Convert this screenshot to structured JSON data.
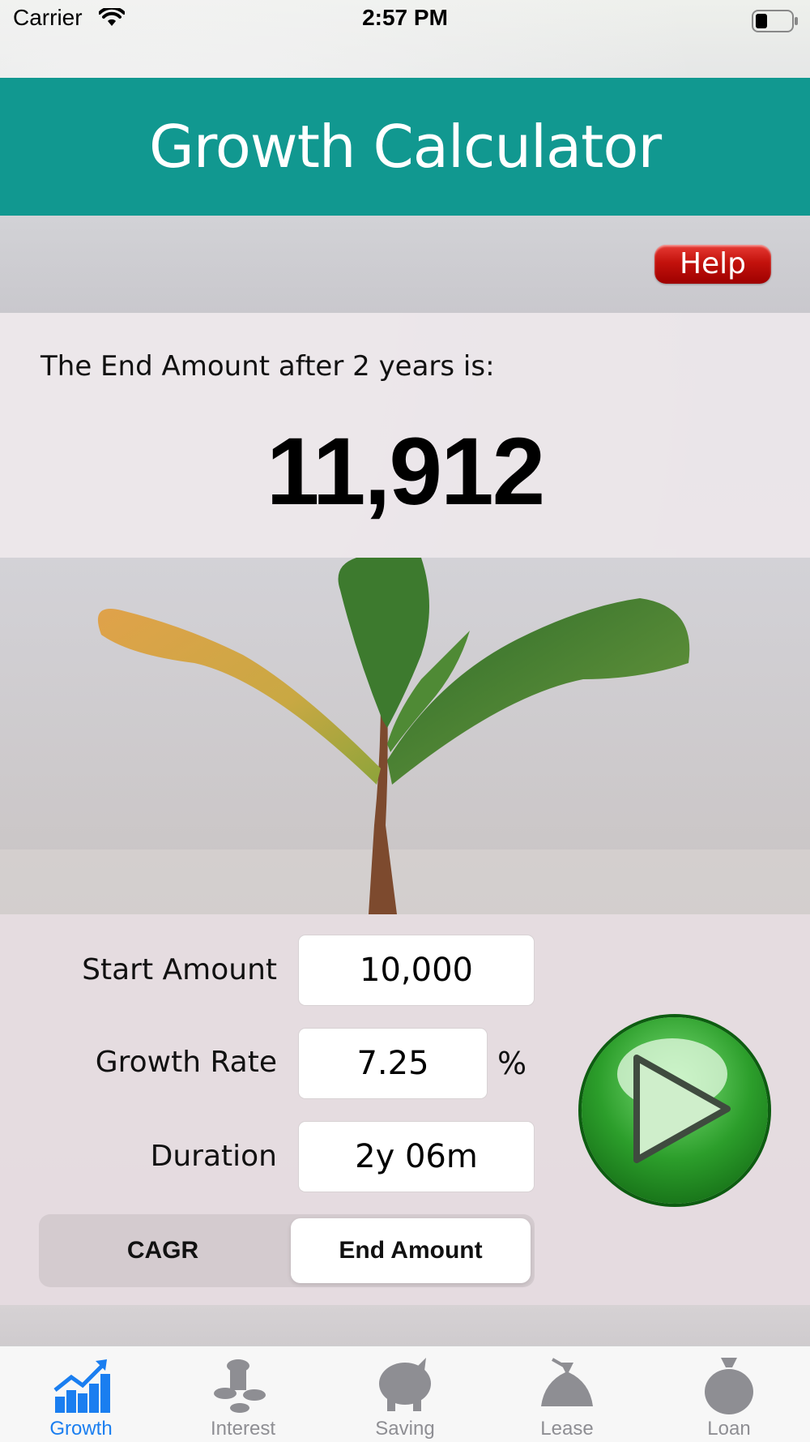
{
  "status_bar": {
    "carrier": "Carrier",
    "time": "2:57 PM"
  },
  "header": {
    "title": "Growth Calculator"
  },
  "help": {
    "label": "Help"
  },
  "result": {
    "label": "The End Amount after 2 years is:",
    "value": "11,912"
  },
  "inputs": {
    "start_amount": {
      "label": "Start Amount",
      "value": "10,000"
    },
    "growth_rate": {
      "label": "Growth Rate",
      "value": "7.25",
      "unit": "%"
    },
    "duration": {
      "label": "Duration",
      "value": "2y 06m"
    }
  },
  "mode": {
    "options": [
      "CAGR",
      "End Amount"
    ],
    "selected": "End Amount"
  },
  "tabs": [
    {
      "label": "Growth",
      "icon": "growth-chart-icon",
      "active": true
    },
    {
      "label": "Interest",
      "icon": "coins-icon",
      "active": false
    },
    {
      "label": "Saving",
      "icon": "piggy-bank-icon",
      "active": false
    },
    {
      "label": "Lease",
      "icon": "money-bag-icon",
      "active": false
    },
    {
      "label": "Loan",
      "icon": "sack-icon",
      "active": false
    }
  ],
  "colors": {
    "header": "#119890",
    "active_tab": "#1a7ef0",
    "inactive_tab": "#8e8e93",
    "help_button": "#c3120c",
    "go_button": "#2c9e2b"
  }
}
